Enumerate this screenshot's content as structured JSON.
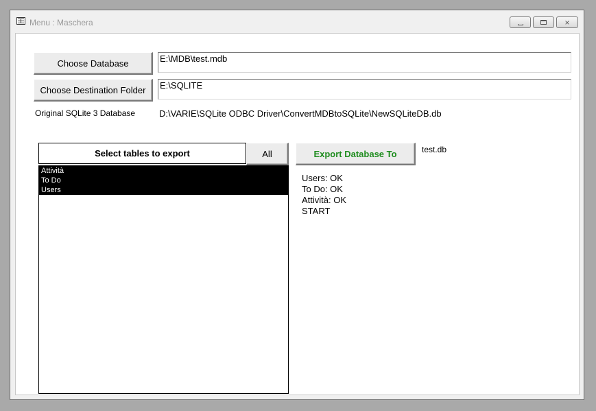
{
  "window": {
    "title": "Menu : Maschera",
    "controls": {
      "minimize": "minimize-icon",
      "maximize": "maximize-icon",
      "close": "×"
    }
  },
  "form": {
    "choose_database_label": "Choose Database",
    "database_path": "E:\\MDB\\test.mdb",
    "choose_destination_label": "Choose Destination Folder",
    "destination_path": "E:\\SQLITE",
    "original_db_label": "Original SQLite 3 Database",
    "original_db_path": "D:\\VARIE\\SQLite ODBC Driver\\ConvertMDBtoSQLite\\NewSQLiteDB.db",
    "select_tables_label": "Select tables to export",
    "all_label": "All",
    "tables": [
      "Attività",
      "To Do",
      "Users"
    ],
    "export_label": "Export Database To",
    "export_filename": "test.db",
    "export_color": "#1e8c1e",
    "status": [
      "Users: OK",
      "To Do: OK",
      "Attività: OK",
      "START"
    ]
  }
}
